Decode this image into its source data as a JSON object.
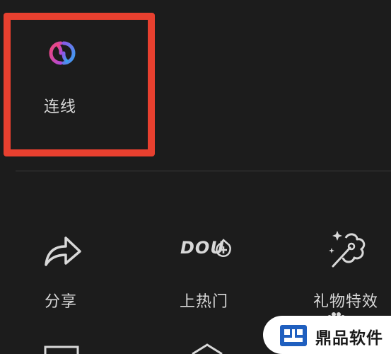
{
  "top_section": {
    "link_item": {
      "label": "连线",
      "icon": "link-rings-icon"
    },
    "highlight_color": "#e8402f"
  },
  "actions": [
    {
      "label": "分享",
      "icon": "share-arrow-icon"
    },
    {
      "label": "上热门",
      "icon": "dou-plus-icon",
      "icon_text": "DOU"
    },
    {
      "label": "礼物特效",
      "icon": "gift-effect-icon"
    }
  ],
  "watermark": {
    "text": "鼎品软件",
    "icon": "wm-logo-icon"
  },
  "colors": {
    "background": "#1c1c1c",
    "label": "#d8d8d8",
    "link_pink": "#e8468a",
    "link_blue": "#4a8cf0"
  }
}
